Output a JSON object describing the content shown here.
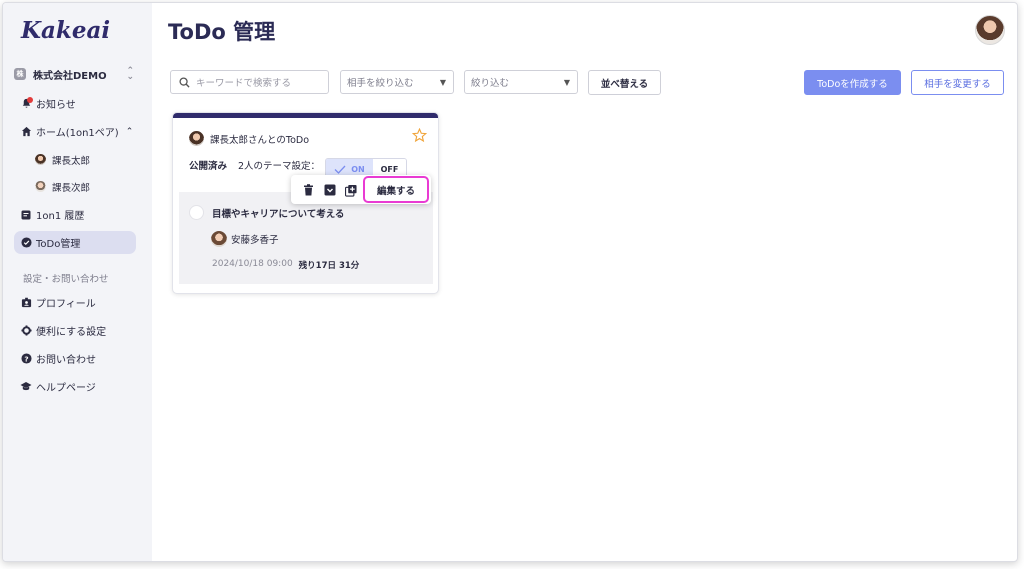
{
  "app": {
    "logo": "Kakeai",
    "page_title": "ToDo 管理"
  },
  "sidebar": {
    "company": {
      "badge": "株",
      "name": "株式会社DEMO",
      "switch_icon": "up-down-icon"
    },
    "items": [
      {
        "label": "お知らせ",
        "icon": "bell-icon"
      },
      {
        "label": "ホーム(1on1ペア)",
        "icon": "home-icon"
      },
      {
        "label": "課長太郎",
        "icon": "avatar"
      },
      {
        "label": "課長次郎",
        "icon": "avatar"
      },
      {
        "label": "1on1 履歴",
        "icon": "document-icon"
      },
      {
        "label": "ToDo管理",
        "icon": "check-circle-icon"
      }
    ],
    "section_label": "設定・お問い合わせ",
    "settings": [
      {
        "label": "プロフィール",
        "icon": "profile-icon"
      },
      {
        "label": "便利にする設定",
        "icon": "gear-icon"
      },
      {
        "label": "お問い合わせ",
        "icon": "question-icon"
      },
      {
        "label": "ヘルプページ",
        "icon": "graduation-cap-icon"
      }
    ]
  },
  "toolbar": {
    "search_placeholder": "キーワードで検索する",
    "filter_partner": "相手を絞り込む",
    "filter_narrow": "絞り込む",
    "sort_label": "並べ替える",
    "create_label": "ToDoを作成する",
    "change_partner_label": "相手を変更する"
  },
  "card": {
    "title": "課長太郎さんとのToDo",
    "status": "公開済み",
    "theme_label": "2人のテーマ設定：",
    "toggle_on": "ON",
    "toggle_off": "OFF",
    "edit_label": "編集する",
    "todo": {
      "title": "目標やキャリアについて考える",
      "assignee": "安藤多香子",
      "due": "2024/10/18 09:00",
      "remaining": "残り17日 31分"
    }
  },
  "colors": {
    "primary": "#7b8ef0",
    "navy": "#2f2b6b",
    "highlight": "#e93bd3",
    "star": "#f0a43a"
  }
}
